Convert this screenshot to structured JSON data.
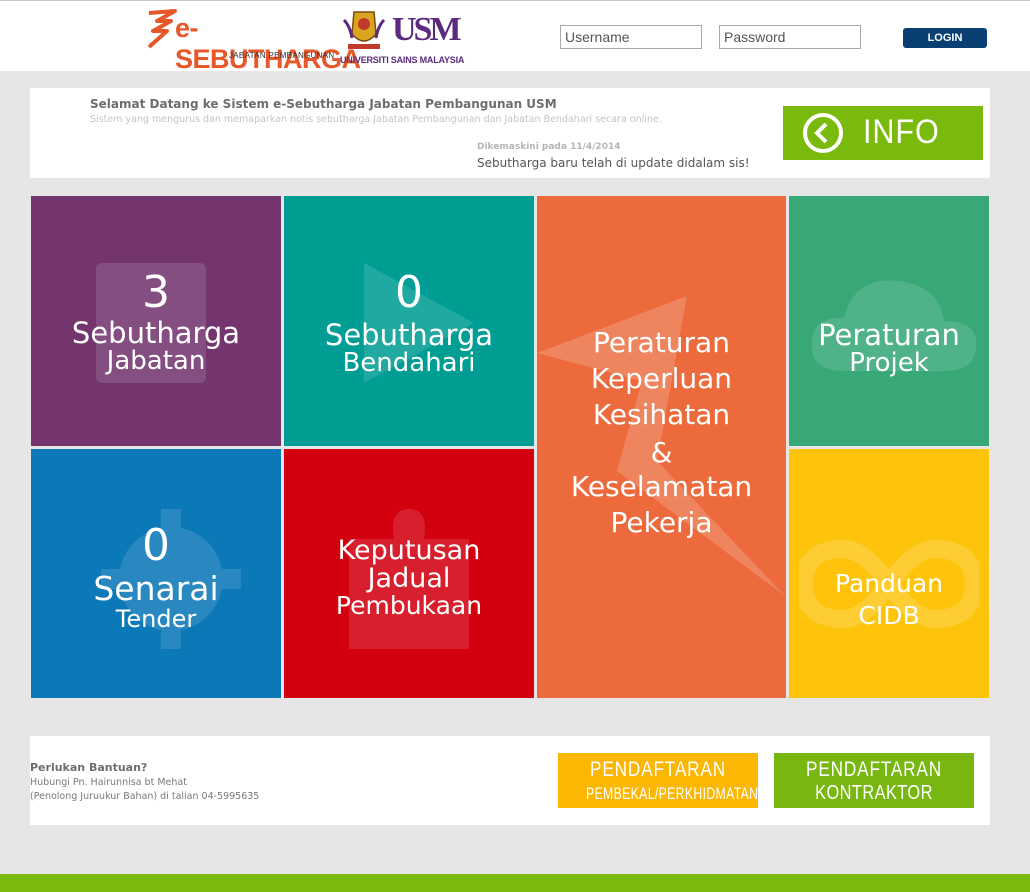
{
  "header": {
    "brand_name": "e-SEBUTHARGA",
    "brand_sub": "JABATAN PEMBANGUNAN",
    "usm_logo_text": "USM",
    "usm_full": "UNIVERSITI SAINS MALAYSIA",
    "username_placeholder": "Username",
    "password_placeholder": "Password",
    "login_label": "LOGIN",
    "login_button_color": "#0a3f73"
  },
  "welcome": {
    "title": "Selamat Datang ke Sistem e-Sebutharga Jabatan Pembangunan USM",
    "description": "Sistem yang mengurus dan memaparkan notis sebutharga Jabatan Pembangunan dan Jabatan Bendahari secara online.",
    "updated": "Dikemaskini pada 11/4/2014",
    "marquee": "Sebutharga baru telah di update didalam sis!",
    "info_label": "INFO",
    "info_color": "#7aba0c"
  },
  "tiles": {
    "jabatan": {
      "count": "3",
      "line1": "Sebutharga",
      "line2": "Jabatan",
      "color": "#74356f"
    },
    "bendahari": {
      "count": "0",
      "line1": "Sebutharga",
      "line2": "Bendahari",
      "color": "#009d94"
    },
    "keperluan": {
      "line1": "Peraturan",
      "line2": "Keperluan",
      "line3": "Kesihatan",
      "line4": "&",
      "line5": "Keselamatan",
      "line6": "Pekerja",
      "color": "#ec6a3c"
    },
    "projek": {
      "line1": "Peraturan",
      "line2": "Projek",
      "color": "#38a877"
    },
    "tender": {
      "count": "0",
      "line1": "Senarai",
      "line2": "Tender",
      "color": "#0b78b7"
    },
    "keputusan": {
      "line1": "Keputusan",
      "line2": "Jadual",
      "line3": "Pembukaan",
      "color": "#d30010"
    },
    "cidb": {
      "line1": "Panduan",
      "line2": "CIDB",
      "color": "#fdc40b"
    }
  },
  "help": {
    "heading": "Perlukan Bantuan?",
    "line1": "Hubungi Pn. Hairunnisa bt Mehat",
    "line2": "(Penolong Juruukur Bahan) di talian 04-5995635"
  },
  "registration": {
    "pembekal": {
      "line1": "PENDAFTARAN",
      "line2": "PEMBEKAL/PERKHIDMATAN",
      "color": "#fbb703"
    },
    "kontraktor": {
      "line1": "PENDAFTARAN",
      "line2": "KONTRAKTOR",
      "color": "#78b710"
    }
  }
}
